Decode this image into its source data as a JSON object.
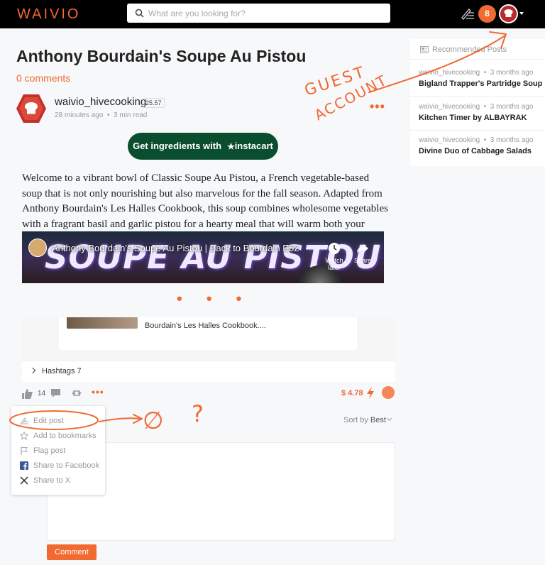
{
  "header": {
    "logo": "WAIVIO",
    "search_placeholder": "What are you looking for?",
    "notification_count": "8",
    "accent": "#f06a32"
  },
  "post": {
    "title": "Anthony Bourdain's Soupe Au Pistou",
    "comments_link": "0 comments",
    "author": "waivio_hivecooking",
    "reputation": "25.57",
    "posted": "28 minutes ago",
    "read_time": "3 min read",
    "instacart_prefix": "Get ingredients with",
    "instacart_brand": "instacart",
    "instacart_color": "#0b4d2f",
    "body": "Welcome to a vibrant bowl of Classic Soupe Au Pistou, a French vegetable-based soup that is not only nourishing but also marvelous for the fall season. Adapted from Anthony Bourdain's Les Halles Cookbook, this soup combines wholesome vegetables with a fragrant basil and garlic pistou for a hearty meal that will warm both your body and soul.",
    "video": {
      "title": "Anthony Bourdain's Soupe Au Pistou | Back to Bourdain E52",
      "overlay": "SOUPE AU PISTOU",
      "watch_later": "Watch later",
      "share": "Share"
    },
    "embed_text": "Bourdain's Les Halles Cookbook....",
    "hashtags": "Hashtags 7",
    "likes": "14",
    "payout": "$ 4.78"
  },
  "comments": {
    "sort_prefix": "Sort by",
    "sort_value": "Best",
    "submit_label": "Comment"
  },
  "menu": {
    "items": [
      {
        "label": "Edit post",
        "icon": "edit-icon"
      },
      {
        "label": "Add to bookmarks",
        "icon": "star-icon"
      },
      {
        "label": "Flag post",
        "icon": "flag-icon"
      },
      {
        "label": "Share to Facebook",
        "icon": "facebook-icon"
      },
      {
        "label": "Share to X",
        "icon": "x-icon"
      }
    ]
  },
  "sidebar": {
    "header": "Recommended Posts",
    "items": [
      {
        "author": "waivio_hivecooking",
        "time": "3 months ago",
        "title": "Bigland Trapper's Partridge Soup"
      },
      {
        "author": "waivio_hivecooking",
        "time": "3 months ago",
        "title": "Kitchen Timer by ALBAYRAK"
      },
      {
        "author": "waivio_hivecooking",
        "time": "3 months ago",
        "title": "Divine Duo of Cabbage Salads"
      }
    ]
  },
  "annotations": {
    "guest_line1": "GUEST",
    "guest_line2": "ACCOUNT",
    "empty_set": "∅",
    "question": "?",
    "ellipsis": "• • •"
  }
}
